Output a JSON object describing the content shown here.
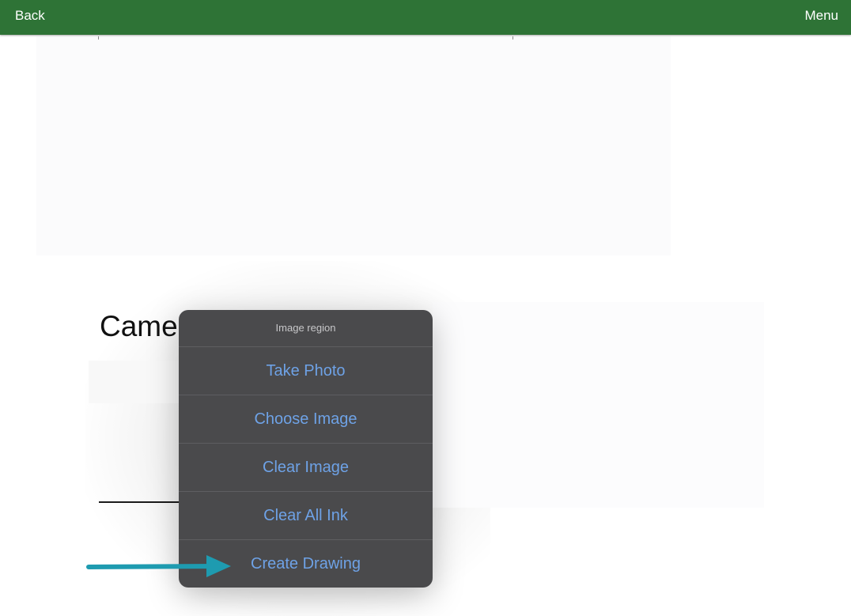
{
  "topbar": {
    "back_label": "Back",
    "menu_label": "Menu",
    "background": "#2e7336"
  },
  "page": {
    "section_label": "Came"
  },
  "popover": {
    "title": "Image region",
    "items": [
      {
        "label": "Take Photo"
      },
      {
        "label": "Choose Image"
      },
      {
        "label": "Clear Image"
      },
      {
        "label": "Clear All Ink"
      },
      {
        "label": "Create Drawing"
      }
    ],
    "item_color": "#6ea2e6",
    "background": "#4a4a4c"
  },
  "annotation": {
    "arrow_icon": "arrow-right-icon",
    "arrow_color": "#1e9bb0",
    "points_to": "Create Drawing"
  }
}
